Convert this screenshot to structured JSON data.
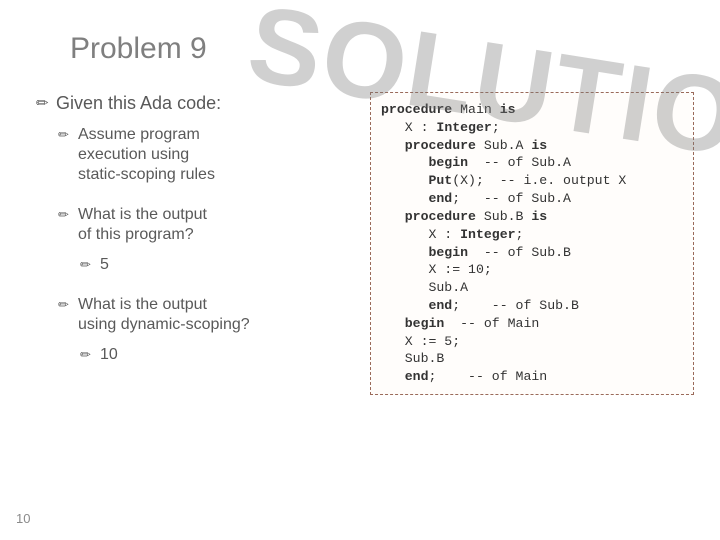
{
  "watermark": "SOLUTIONS",
  "title": "Problem 9",
  "page_number": "10",
  "left": {
    "heading": "Given this Ada code:",
    "b1": {
      "lead": "Assume",
      "rest": " program",
      "cont1": "execution using",
      "cont2": "static-scoping rules"
    },
    "b2": {
      "lead": "What",
      "rest": " is the output",
      "cont1": "of this program?",
      "ans": "5"
    },
    "b3": {
      "lead": "What",
      "rest": " is the output",
      "cont1": "using dynamic-scoping?",
      "ans": "10"
    }
  },
  "code": {
    "l01a": "procedure",
    "l01b": " Main ",
    "l01c": "is",
    "l02a": "   X : ",
    "l02b": "Integer",
    "l02c": ";",
    "l03a": "   procedure",
    "l03b": " Sub.A ",
    "l03c": "is",
    "l04a": "      begin",
    "l04b": "  -- of Sub.A",
    "l05a": "      Put",
    "l05b": "(X);  -- i.e. output X",
    "l06a": "      end",
    "l06b": ";   -- of Sub.A",
    "l07a": "   procedure",
    "l07b": " Sub.B ",
    "l07c": "is",
    "l08a": "      X : ",
    "l08b": "Integer",
    "l08c": ";",
    "l09a": "      begin",
    "l09b": "  -- of Sub.B",
    "l10": "      X := 10;",
    "l11": "      Sub.A",
    "l12a": "      end",
    "l12b": ";    -- of Sub.B",
    "l13a": "   begin",
    "l13b": "  -- of Main",
    "l14": "   X := 5;",
    "l15": "   Sub.B",
    "l16a": "   end",
    "l16b": ";    -- of Main"
  }
}
